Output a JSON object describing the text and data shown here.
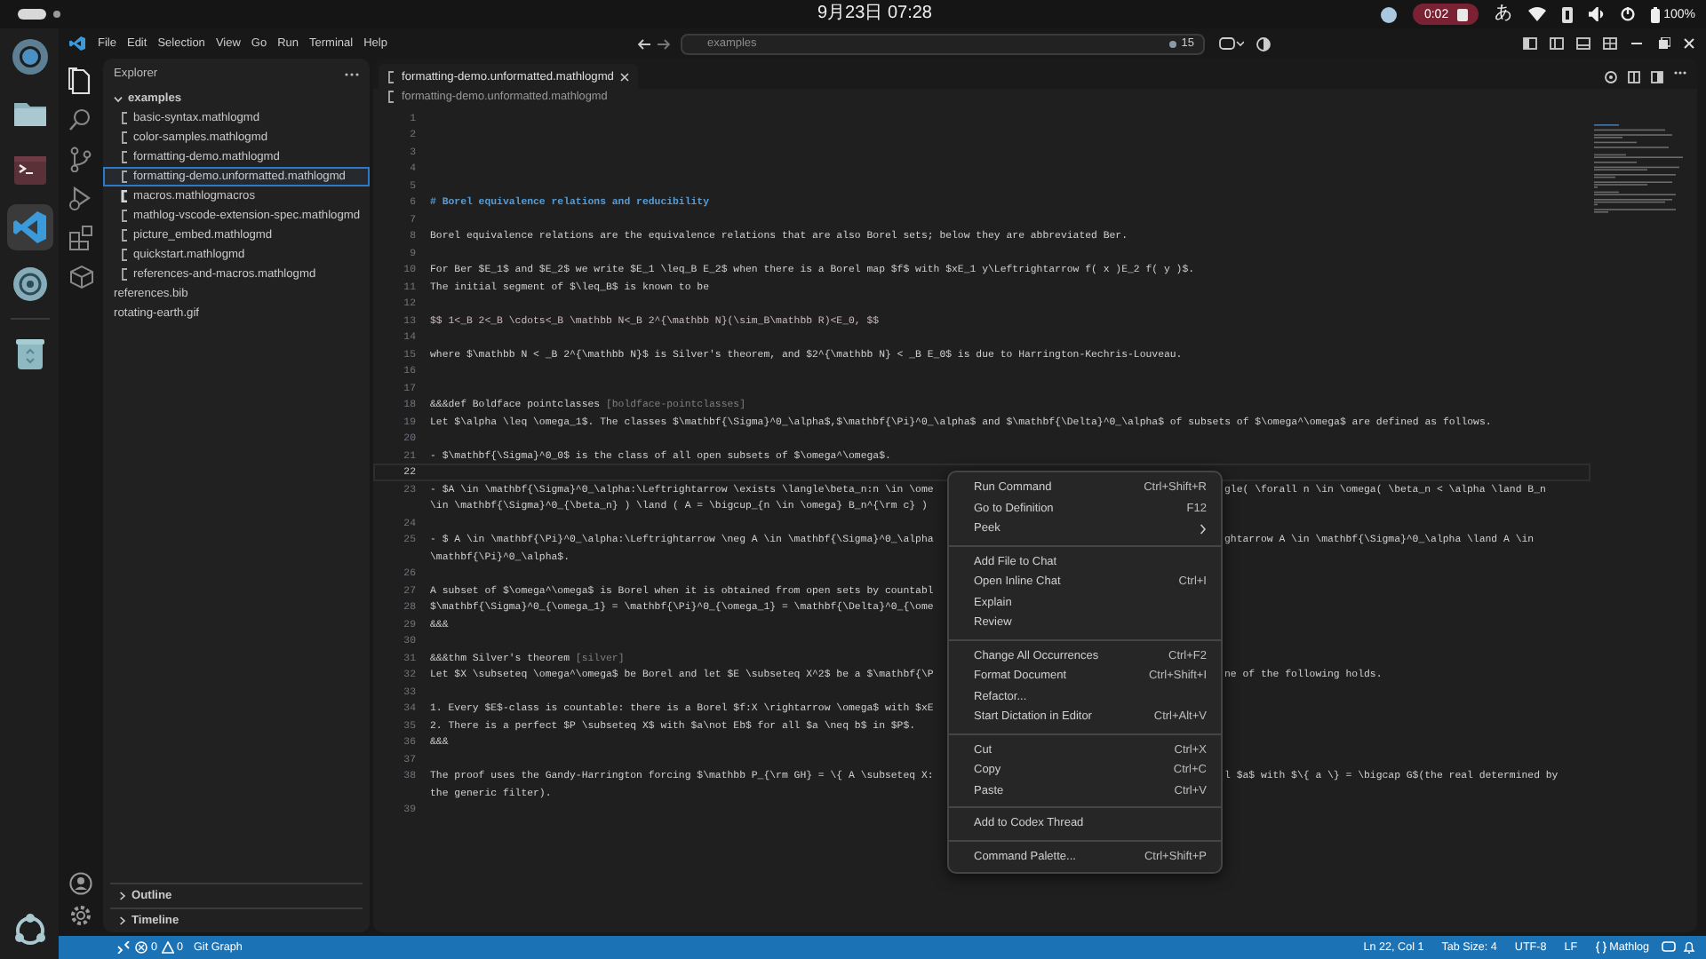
{
  "top_bar": {
    "date_time": "9月23日 07:28",
    "recording": "0:02",
    "input_method": "あ",
    "battery": "100%"
  },
  "dock": {
    "apps": [
      {
        "kind": "browser",
        "selected": false
      },
      {
        "kind": "files",
        "selected": false
      },
      {
        "kind": "terminal",
        "selected": false
      },
      {
        "kind": "code",
        "selected": true
      },
      {
        "kind": "settings",
        "selected": false
      },
      {
        "kind": "trash",
        "selected": false
      }
    ]
  },
  "title_bar": {
    "menus": [
      "File",
      "Edit",
      "Selection",
      "View",
      "Go",
      "Run",
      "Terminal",
      "Help"
    ],
    "search": "examples",
    "badge": "15"
  },
  "activity_bar": {
    "items": [
      {
        "kind": "explorer",
        "selected": true
      },
      {
        "kind": "search",
        "selected": false
      },
      {
        "kind": "source-control",
        "selected": false
      },
      {
        "kind": "run",
        "selected": false
      },
      {
        "kind": "extensions",
        "selected": false
      },
      {
        "kind": "package",
        "selected": false
      }
    ]
  },
  "sidebar": {
    "title": "Explorer",
    "tree": [
      {
        "label": "examples",
        "kind": "folder",
        "expanded": true,
        "selected": false,
        "children": [
          {
            "label": "basic-syntax.mathlogmd",
            "kind": "doc",
            "selected": false
          },
          {
            "label": "color-samples.mathlogmd",
            "kind": "doc",
            "selected": false
          },
          {
            "label": "formatting-demo.mathlogmd",
            "kind": "doc",
            "selected": false
          },
          {
            "label": "formatting-demo.unformatted.mathlogmd",
            "kind": "doc",
            "selected": true
          },
          {
            "label": "macros.mathlogmacros",
            "kind": "macros",
            "selected": false
          },
          {
            "label": "mathlog-vscode-extension-spec.mathlogmd",
            "kind": "doc",
            "selected": false
          },
          {
            "label": "picture_embed.mathlogmd",
            "kind": "doc",
            "selected": false
          },
          {
            "label": "quickstart.mathlogmd",
            "kind": "doc",
            "selected": false
          },
          {
            "label": "references-and-macros.mathlogmd",
            "kind": "doc",
            "selected": false
          }
        ]
      },
      {
        "label": "references.bib",
        "kind": "plain",
        "selected": false
      },
      {
        "label": "rotating-earth.gif",
        "kind": "plain",
        "selected": false
      }
    ],
    "sections": [
      {
        "label": "Outline",
        "expanded": false
      },
      {
        "label": "Timeline",
        "expanded": false
      }
    ]
  },
  "editor": {
    "tab": {
      "label": "formatting-demo.unformatted.mathlogmd",
      "selected": true
    },
    "breadcrumb": "formatting-demo.unformatted.mathlogmd",
    "lines": [
      {
        "number": "1",
        "current": false
      },
      {
        "number": "2",
        "current": false
      },
      {
        "number": "3",
        "current": false
      },
      {
        "number": "4",
        "current": false
      },
      {
        "number": "5",
        "current": false
      },
      {
        "number": "6",
        "current": false,
        "rows": [
          {
            "segments": [
              {
                "kind": "heading",
                "text": "# Borel equivalence relations and reducibility"
              }
            ]
          }
        ]
      },
      {
        "number": "7",
        "current": false
      },
      {
        "number": "8",
        "current": false,
        "rows": [
          {
            "segments": [
              {
                "kind": "text",
                "text": "Borel equivalence relations are the equivalence relations that are also Borel sets; below they are abbreviated Ber."
              }
            ]
          }
        ]
      },
      {
        "number": "9",
        "current": false
      },
      {
        "number": "10",
        "current": false,
        "rows": [
          {
            "segments": [
              {
                "kind": "text",
                "text": "For Ber $E_1$ and $E_2$ we write $E_1 \\leq_B E_2$ when there is a Borel map $f$ with $xE_1 y\\Leftrightarrow f( x )E_2 f( y )$."
              }
            ]
          }
        ]
      },
      {
        "number": "11",
        "current": false,
        "rows": [
          {
            "segments": [
              {
                "kind": "text",
                "text": "The initial segment of $\\leq_B$ is known to be"
              }
            ]
          }
        ]
      },
      {
        "number": "12",
        "current": false
      },
      {
        "number": "13",
        "current": false,
        "rows": [
          {
            "segments": [
              {
                "kind": "display",
                "text": "$$ 1<_B 2<_B \\cdots<_B \\mathbb N<_B 2^{\\mathbb N}(\\sim_B\\mathbb R)<E_0, $$"
              }
            ]
          }
        ]
      },
      {
        "number": "14",
        "current": false
      },
      {
        "number": "15",
        "current": false,
        "rows": [
          {
            "segments": [
              {
                "kind": "text",
                "text": "where $\\mathbb N < _B 2^{\\mathbb N}$ is Silver's theorem, and $2^{\\mathbb N} < _B E_0$ is due to Harrington-Kechris-Louveau."
              }
            ]
          }
        ]
      },
      {
        "number": "16",
        "current": false
      },
      {
        "number": "17",
        "current": false
      },
      {
        "number": "18",
        "current": false,
        "rows": [
          {
            "segments": [
              {
                "kind": "text",
                "text": "&&&def Boldface pointclasses "
              },
              {
                "kind": "label",
                "text": "[boldface-pointclasses]"
              }
            ]
          }
        ]
      },
      {
        "number": "19",
        "current": false,
        "rows": [
          {
            "segments": [
              {
                "kind": "text",
                "text": "Let $\\alpha \\leq \\omega_1$. The classes $\\mathbf{\\Sigma}^0_\\alpha$,$\\mathbf{\\Pi}^0_\\alpha$ and $\\mathbf{\\Delta}^0_\\alpha$ of subsets of $\\omega^\\omega$ are defined as follows."
              }
            ]
          }
        ]
      },
      {
        "number": "20",
        "current": false
      },
      {
        "number": "21",
        "current": false,
        "rows": [
          {
            "segments": [
              {
                "kind": "text",
                "text": "- $\\mathbf{\\Sigma}^0_0$ is the class of all open subsets of $\\omega^\\omega$."
              }
            ]
          }
        ]
      },
      {
        "number": "22",
        "current": true
      },
      {
        "number": "23",
        "current": false,
        "rows": [
          {
            "segments": [
              {
                "kind": "text",
                "text": "- $A \\in \\mathbf{\\Sigma}^0_\\alpha:\\Leftrightarrow \\exists \\langle\\beta_n:n \\in \\ome"
              }
            ],
            "after_menu": "gle( \\forall n \\in \\omega( \\beta_n < \\alpha \\land B_n"
          },
          {
            "segments": [
              {
                "kind": "text",
                "text": "\\in \\mathbf{\\Sigma}^0_{\\beta_n} ) \\land ( A = \\bigcup_{n \\in \\omega} B_n^{\\rm c} )"
              }
            ]
          }
        ]
      },
      {
        "number": "24",
        "current": false
      },
      {
        "number": "25",
        "current": false,
        "rows": [
          {
            "segments": [
              {
                "kind": "text",
                "text": "- $ A \\in \\mathbf{\\Pi}^0_\\alpha:\\Leftrightarrow \\neg A \\in \\mathbf{\\Sigma}^0_\\alpha"
              }
            ],
            "after_menu": "ghtarrow A \\in \\mathbf{\\Sigma}^0_\\alpha \\land A \\in"
          },
          {
            "segments": [
              {
                "kind": "text",
                "text": "\\mathbf{\\Pi}^0_\\alpha$."
              }
            ]
          }
        ]
      },
      {
        "number": "26",
        "current": false
      },
      {
        "number": "27",
        "current": false,
        "rows": [
          {
            "segments": [
              {
                "kind": "text",
                "text": "A subset of $\\omega^\\omega$ is Borel when it is obtained from open sets by countabl"
              }
            ]
          }
        ]
      },
      {
        "number": "28",
        "current": false,
        "rows": [
          {
            "segments": [
              {
                "kind": "text",
                "text": "$\\mathbf{\\Sigma}^0_{\\omega_1} = \\mathbf{\\Pi}^0_{\\omega_1} = \\mathbf{\\Delta}^0_{\\ome"
              }
            ]
          }
        ]
      },
      {
        "number": "29",
        "current": false,
        "rows": [
          {
            "segments": [
              {
                "kind": "text",
                "text": "&&&"
              }
            ]
          }
        ]
      },
      {
        "number": "30",
        "current": false
      },
      {
        "number": "31",
        "current": false,
        "rows": [
          {
            "segments": [
              {
                "kind": "text",
                "text": "&&&thm Silver's theorem "
              },
              {
                "kind": "label",
                "text": "[silver]"
              }
            ]
          }
        ]
      },
      {
        "number": "32",
        "current": false,
        "rows": [
          {
            "segments": [
              {
                "kind": "text",
                "text": "Let $X \\subseteq \\omega^\\omega$ be Borel and let $E \\subseteq X^2$ be a $\\mathbf{\\P"
              }
            ],
            "after_menu": "ne of the following holds."
          }
        ]
      },
      {
        "number": "33",
        "current": false
      },
      {
        "number": "34",
        "current": false,
        "rows": [
          {
            "segments": [
              {
                "kind": "text",
                "text": "1. Every $E$-class is countable: there is a Borel $f:X \\rightarrow \\omega$ with $xE"
              }
            ]
          }
        ]
      },
      {
        "number": "35",
        "current": false,
        "rows": [
          {
            "segments": [
              {
                "kind": "text",
                "text": "2. There is a perfect $P \\subseteq X$ with $a\\not Eb$ for all $a \\neq b$ in $P$."
              }
            ]
          }
        ]
      },
      {
        "number": "36",
        "current": false,
        "rows": [
          {
            "segments": [
              {
                "kind": "text",
                "text": "&&&"
              }
            ]
          }
        ]
      },
      {
        "number": "37",
        "current": false
      },
      {
        "number": "38",
        "current": false,
        "rows": [
          {
            "segments": [
              {
                "kind": "text",
                "text": "The proof uses the Gandy-Harrington forcing $\\mathbb P_{\\rm GH} = \\{ A \\subseteq X:"
              }
            ],
            "after_menu": "l $a$ with $\\{ a \\} = \\bigcap G$(the real determined by"
          },
          {
            "segments": [
              {
                "kind": "text",
                "text": "the generic filter)."
              }
            ]
          }
        ]
      },
      {
        "number": "39",
        "current": false
      }
    ]
  },
  "context_menu": {
    "groups": [
      [
        {
          "label": "Run Command",
          "shortcut": "Ctrl+Shift+R",
          "submenu": false
        },
        {
          "label": "Go to Definition",
          "shortcut": "F12",
          "submenu": false
        },
        {
          "label": "Peek",
          "submenu": true
        }
      ],
      [
        {
          "label": "Add File to Chat",
          "submenu": false
        },
        {
          "label": "Open Inline Chat",
          "shortcut": "Ctrl+I",
          "submenu": false
        },
        {
          "label": "Explain",
          "submenu": false
        },
        {
          "label": "Review",
          "submenu": false
        }
      ],
      [
        {
          "label": "Change All Occurrences",
          "shortcut": "Ctrl+F2",
          "submenu": false
        },
        {
          "label": "Format Document",
          "shortcut": "Ctrl+Shift+I",
          "submenu": false
        },
        {
          "label": "Refactor...",
          "submenu": false
        },
        {
          "label": "Start Dictation in Editor",
          "shortcut": "Ctrl+Alt+V",
          "submenu": false
        }
      ],
      [
        {
          "label": "Cut",
          "shortcut": "Ctrl+X",
          "submenu": false
        },
        {
          "label": "Copy",
          "shortcut": "Ctrl+C",
          "submenu": false
        },
        {
          "label": "Paste",
          "shortcut": "Ctrl+V",
          "submenu": false
        }
      ],
      [
        {
          "label": "Add to Codex Thread",
          "submenu": false
        }
      ],
      [
        {
          "label": "Command Palette...",
          "shortcut": "Ctrl+Shift+P",
          "submenu": false
        }
      ]
    ]
  },
  "status_bar": {
    "errors": "0",
    "warnings": "0",
    "git": "Git Graph",
    "items": [
      "Ln 22, Col 1",
      "Tab Size: 4",
      "UTF-8",
      "LF"
    ],
    "language": "Mathlog"
  }
}
